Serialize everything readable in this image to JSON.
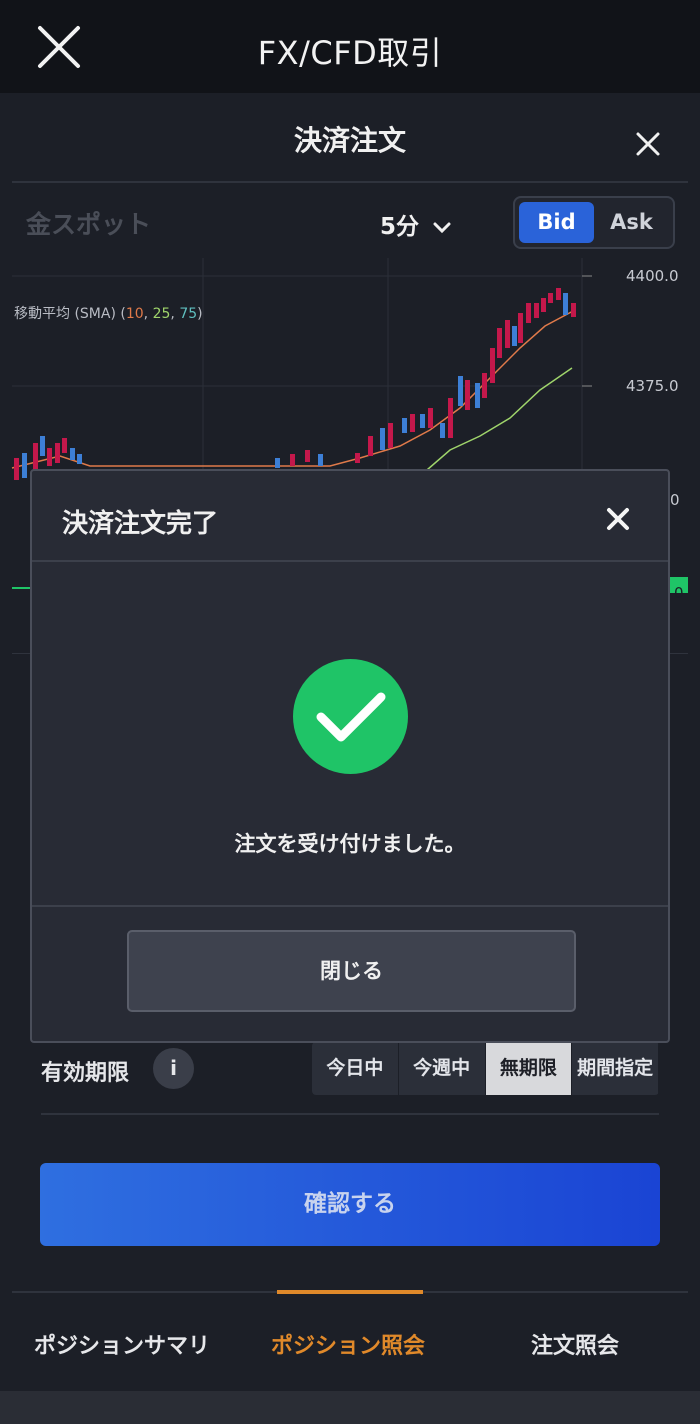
{
  "app": {
    "title": "FX/CFD取引"
  },
  "sheet": {
    "title": "決済注文"
  },
  "chart": {
    "instrument": "金スポット",
    "timeframe": "5分",
    "bid_label": "Bid",
    "ask_label": "Ask",
    "sma_prefix": "移動平均 (SMA) (",
    "sma_10": "10",
    "sma_25": "25",
    "sma_75": "75",
    "sma_suffix": ")",
    "comma": ", ",
    "y_ticks": [
      "4400.0",
      "4375.0",
      "0",
      "0"
    ]
  },
  "expiry": {
    "label": "有効期限",
    "info": "i",
    "options": [
      "今日中",
      "今週中",
      "無期限",
      "期間指定"
    ],
    "selected": "無期限"
  },
  "confirm_label": "確認する",
  "nav": {
    "items": [
      "ポジションサマリ",
      "ポジション照会",
      "注文照会"
    ],
    "active": "ポジション照会"
  },
  "modal": {
    "title": "決済注文完了",
    "message": "注文を受け付けました。",
    "close_label": "閉じる"
  }
}
